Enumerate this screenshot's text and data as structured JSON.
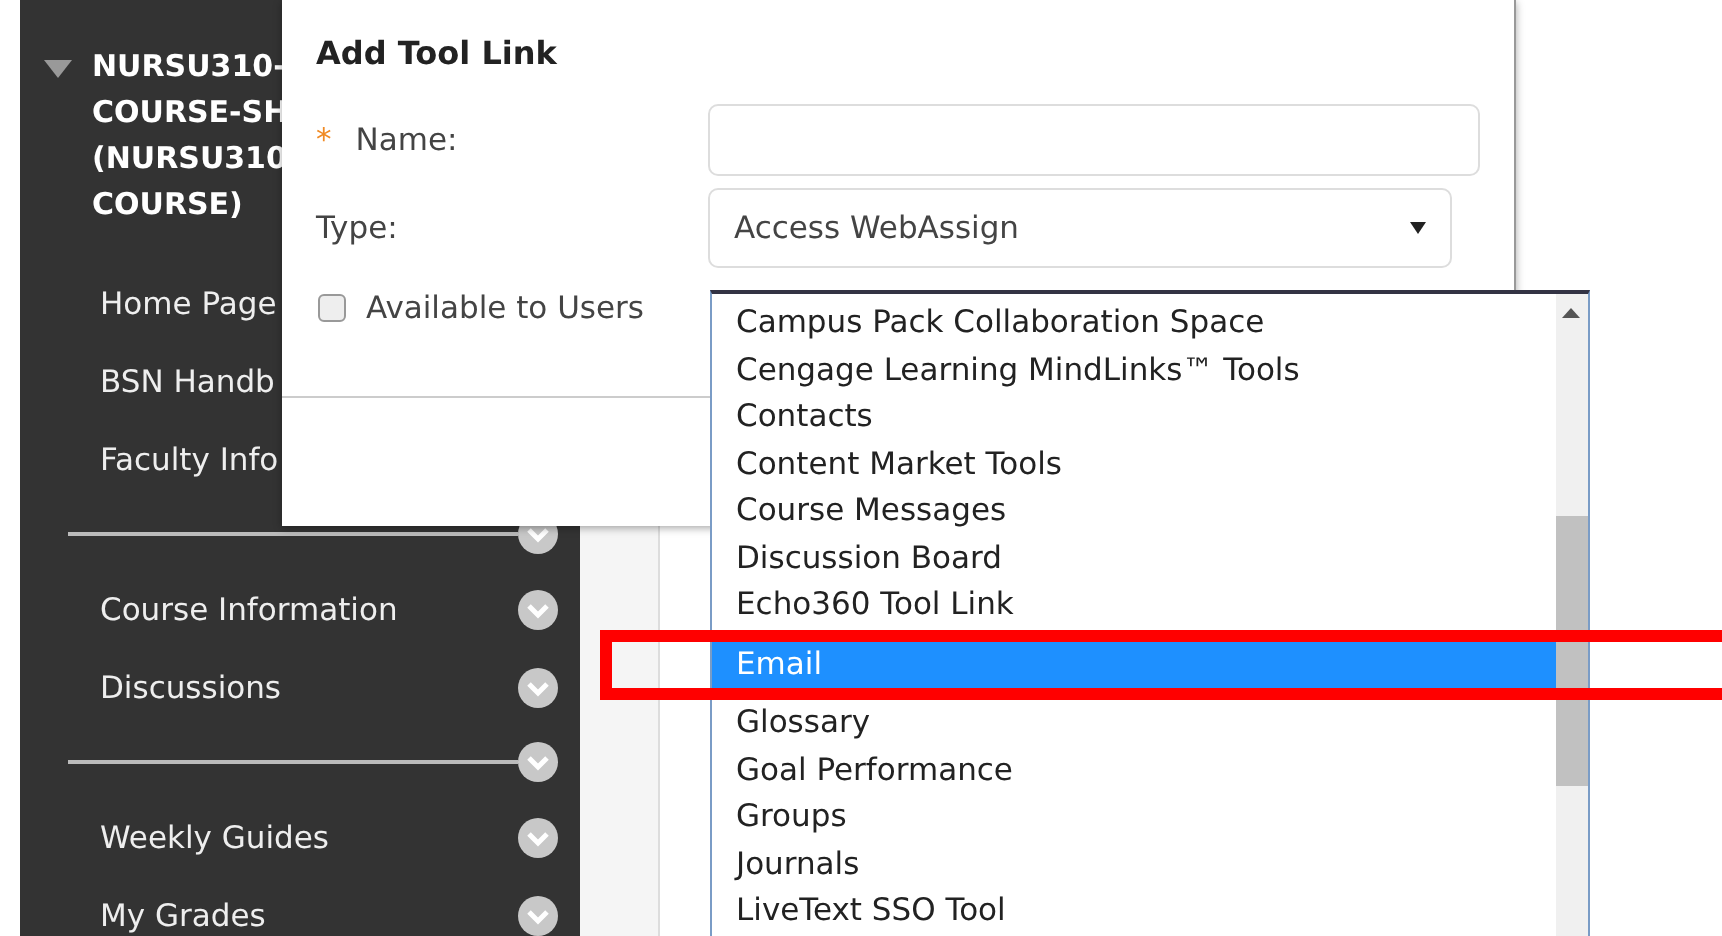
{
  "sidebar": {
    "course_title": [
      "NURSU310-",
      "COURSE-SH",
      "(NURSU310",
      "COURSE)"
    ],
    "expanded": true,
    "items": [
      {
        "kind": "link",
        "label": "Home Page",
        "menu_button": false
      },
      {
        "kind": "link",
        "label": "BSN Handb",
        "menu_button": false
      },
      {
        "kind": "link",
        "label": "Faculty Info",
        "menu_button": false
      },
      {
        "kind": "divider"
      },
      {
        "kind": "link",
        "label": "Course Information",
        "menu_button": true
      },
      {
        "kind": "link",
        "label": "Discussions",
        "menu_button": true
      },
      {
        "kind": "divider"
      },
      {
        "kind": "link",
        "label": "Weekly Guides",
        "menu_button": true
      },
      {
        "kind": "link",
        "label": "My Grades",
        "menu_button": true
      }
    ]
  },
  "dialog": {
    "title": "Add Tool Link",
    "name_field": {
      "label": "Name:",
      "required_mark": "*"
    },
    "type_field": {
      "label": "Type:",
      "value": "Access WebAssign",
      "expanded": true
    },
    "available_checkbox": {
      "label": "Available to Users",
      "checked": false
    }
  },
  "dropdown": {
    "options": [
      {
        "label": "Campus Pack Collaboration Space",
        "selected": false
      },
      {
        "label": "Cengage Learning MindLinks™ Tools",
        "selected": false
      },
      {
        "label": "Contacts",
        "selected": false
      },
      {
        "label": "Content Market Tools",
        "selected": false
      },
      {
        "label": "Course Messages",
        "selected": false
      },
      {
        "label": "Discussion Board",
        "selected": false
      },
      {
        "label": "Echo360 Tool Link",
        "selected": false
      },
      {
        "label": "Email",
        "selected": true
      },
      {
        "label": "Glossary",
        "selected": false
      },
      {
        "label": "Goal Performance",
        "selected": false
      },
      {
        "label": "Groups",
        "selected": false
      },
      {
        "label": "Journals",
        "selected": false
      },
      {
        "label": "LiveText SSO Tool",
        "selected": false
      }
    ]
  },
  "annotation": {
    "kind": "highlight",
    "color": "#ff0000"
  }
}
